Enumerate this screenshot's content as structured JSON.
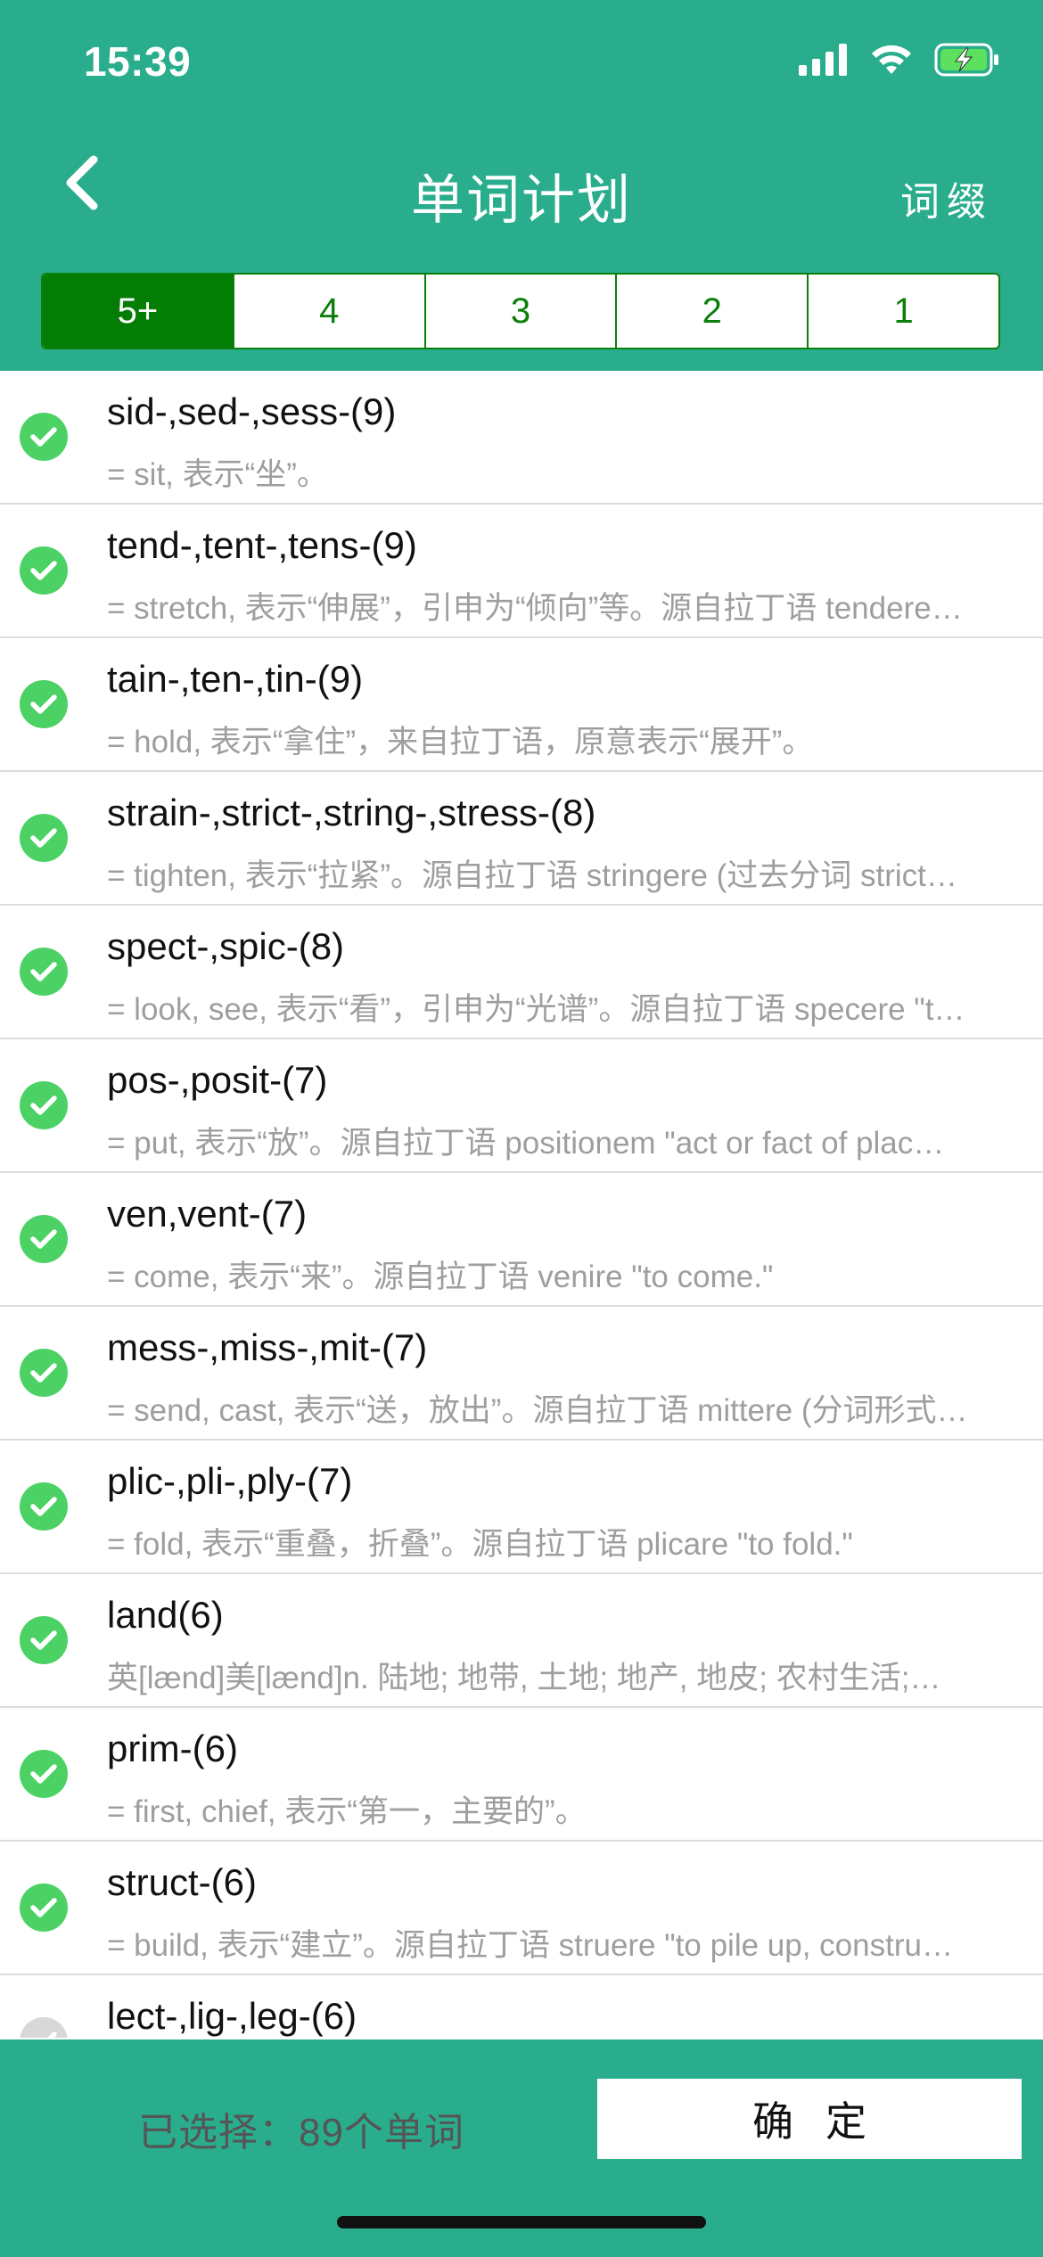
{
  "status": {
    "time": "15:39"
  },
  "nav": {
    "title": "单词计划",
    "right_label": "词缀"
  },
  "segments": [
    "5+",
    "4",
    "3",
    "2",
    "1"
  ],
  "active_segment": "5+",
  "items": [
    {
      "word": "sid-,sed-,sess-(9)",
      "desc": "= sit, 表示“坐”。",
      "checked": true
    },
    {
      "word": "tend-,tent-,tens-(9)",
      "desc": "= stretch, 表示“伸展”，引申为“倾向”等。源自拉丁语 tendere…",
      "checked": true
    },
    {
      "word": "tain-,ten-,tin-(9)",
      "desc": "= hold, 表示“拿住”，来自拉丁语，原意表示“展开”。",
      "checked": true
    },
    {
      "word": "strain-,strict-,string-,stress-(8)",
      "desc": "= tighten, 表示“拉紧”。源自拉丁语 stringere (过去分词 strict…",
      "checked": true
    },
    {
      "word": "spect-,spic-(8)",
      "desc": "= look, see, 表示“看”，引申为“光谱”。源自拉丁语 specere \"t…",
      "checked": true
    },
    {
      "word": "pos-,posit-(7)",
      "desc": "= put, 表示“放”。源自拉丁语 positionem \"act or fact of plac…",
      "checked": true
    },
    {
      "word": "ven,vent-(7)",
      "desc": "= come, 表示“来”。源自拉丁语 venire \"to come.\"",
      "checked": true
    },
    {
      "word": "mess-,miss-,mit-(7)",
      "desc": "= send, cast, 表示“送，放出”。源自拉丁语 mittere (分词形式…",
      "checked": true
    },
    {
      "word": "plic-,pli-,ply-(7)",
      "desc": "= fold, 表示“重叠，折叠”。源自拉丁语 plicare \"to fold.\"",
      "checked": true
    },
    {
      "word": "land(6)",
      "desc": "英[lænd]美[lænd]n. 陆地; 地带, 土地; 地产, 地皮; 农村生活;…",
      "checked": true
    },
    {
      "word": "prim-(6)",
      "desc": "= first, chief, 表示“第一，主要的”。",
      "checked": true
    },
    {
      "word": "struct-(6)",
      "desc": "= build, 表示“建立”。源自拉丁语 struere \"to pile up, constru…",
      "checked": true
    },
    {
      "word": "lect-,lig-,leg-(6)",
      "desc": "",
      "checked": false
    }
  ],
  "footer": {
    "selected": "已选择：89个单词",
    "confirm": "确定"
  },
  "colors": {
    "brand": "#29ad8d",
    "segment_active": "#037d03",
    "check": "#4cd264"
  }
}
